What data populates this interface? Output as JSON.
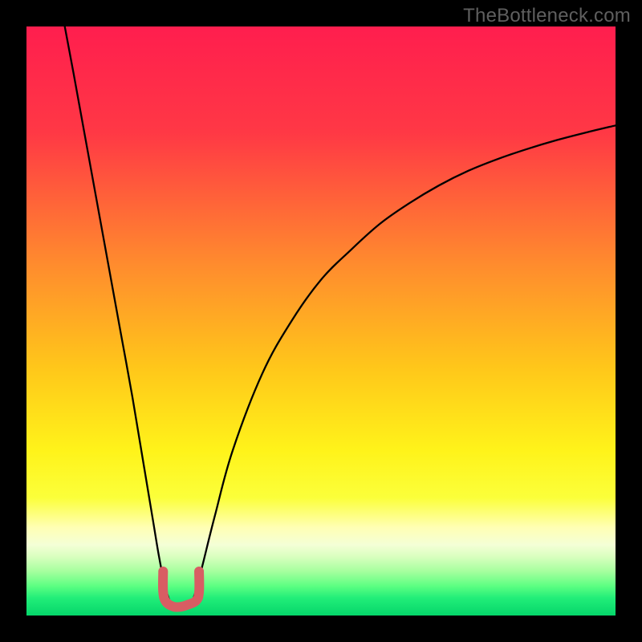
{
  "watermark": "TheBottleneck.com",
  "chart_data": {
    "type": "line",
    "title": "",
    "xlabel": "",
    "ylabel": "",
    "xlim": [
      0,
      100
    ],
    "ylim": [
      0,
      100
    ],
    "series": [
      {
        "name": "left-curve",
        "x": [
          6.5,
          8,
          10,
          12,
          14,
          16,
          18,
          20,
          21.5,
          22.5,
          23.5,
          24.3
        ],
        "y": [
          100,
          92,
          81,
          70,
          59,
          48,
          37,
          25,
          16,
          10,
          5,
          2.5
        ]
      },
      {
        "name": "right-curve",
        "x": [
          28.2,
          29,
          30,
          32,
          35,
          40,
          45,
          50,
          55,
          60,
          65,
          70,
          75,
          80,
          85,
          90,
          95,
          100
        ],
        "y": [
          2.5,
          5,
          9,
          17,
          28,
          41,
          50,
          57,
          62,
          66.5,
          70,
          73,
          75.5,
          77.5,
          79.2,
          80.7,
          82,
          83.2
        ]
      },
      {
        "name": "u-marker",
        "x": [
          23.2,
          23.2,
          23.7,
          25,
          26.3,
          27.3,
          28.8,
          29.3,
          29.3
        ],
        "y": [
          7.5,
          4,
          2.3,
          1.5,
          1.5,
          1.8,
          2.5,
          4,
          7.5
        ]
      }
    ],
    "gradient_stops": [
      {
        "offset": 0,
        "color": "#ff1e4e"
      },
      {
        "offset": 18,
        "color": "#ff3845"
      },
      {
        "offset": 40,
        "color": "#ff8a2e"
      },
      {
        "offset": 58,
        "color": "#ffc71a"
      },
      {
        "offset": 72,
        "color": "#fff31a"
      },
      {
        "offset": 80,
        "color": "#fbff3a"
      },
      {
        "offset": 85,
        "color": "#ffffb3"
      },
      {
        "offset": 88,
        "color": "#f4ffd6"
      },
      {
        "offset": 90,
        "color": "#d9ffbf"
      },
      {
        "offset": 92.5,
        "color": "#a6ff9e"
      },
      {
        "offset": 95,
        "color": "#5cff82"
      },
      {
        "offset": 97,
        "color": "#22ee79"
      },
      {
        "offset": 100,
        "color": "#05d66a"
      }
    ],
    "colors": {
      "curve": "#000000",
      "marker": "#d85d63",
      "frame": "#000000"
    }
  }
}
